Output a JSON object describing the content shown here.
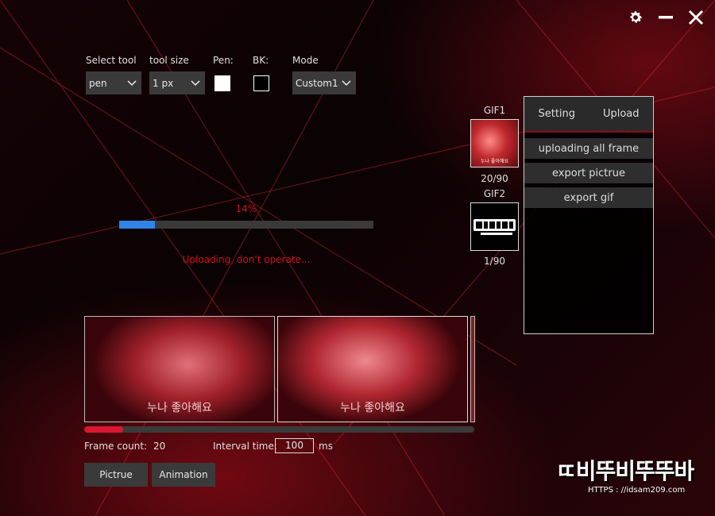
{
  "toolbar": {
    "select_tool_label": "Select tool",
    "tool_value": "pen",
    "tool_size_label": "tool size",
    "tool_size_value": "1 px",
    "pen_label": "Pen:",
    "pen_color": "#ffffff",
    "bk_label": "BK:",
    "bk_color": "#000000",
    "mode_label": "Mode",
    "mode_value": "Custom1"
  },
  "progress": {
    "percent_text": "14%",
    "fraction": 0.14,
    "status_text": "Uploading, don't operate...",
    "accent_color": "#d01020",
    "bar_color": "#2f84e6"
  },
  "gifs": [
    {
      "label": "GIF1",
      "counter": "20/90",
      "thumb_caption": "누나 좋아해요"
    },
    {
      "label": "GIF2",
      "counter": "1/90"
    }
  ],
  "side_panel": {
    "tabs": [
      "Setting",
      "Upload"
    ],
    "buttons": [
      "uploading all frame",
      "export pictrue",
      "export gif"
    ]
  },
  "frames": [
    {
      "caption": "누나 좋아해요"
    },
    {
      "caption": "누나 좋아해요"
    }
  ],
  "timeline": {
    "fraction": 0.1
  },
  "bottom": {
    "frame_count_label": "Frame count:",
    "frame_count_value": "20",
    "interval_label": "Interval time:",
    "interval_value": "100",
    "interval_unit": "ms",
    "pictrue_button": "Pictrue",
    "animation_button": "Animation"
  },
  "watermark": {
    "logo_text": "ㄸ비뚜비뚜뚜바",
    "url_text": "HTTPS : //idsam209.com"
  }
}
